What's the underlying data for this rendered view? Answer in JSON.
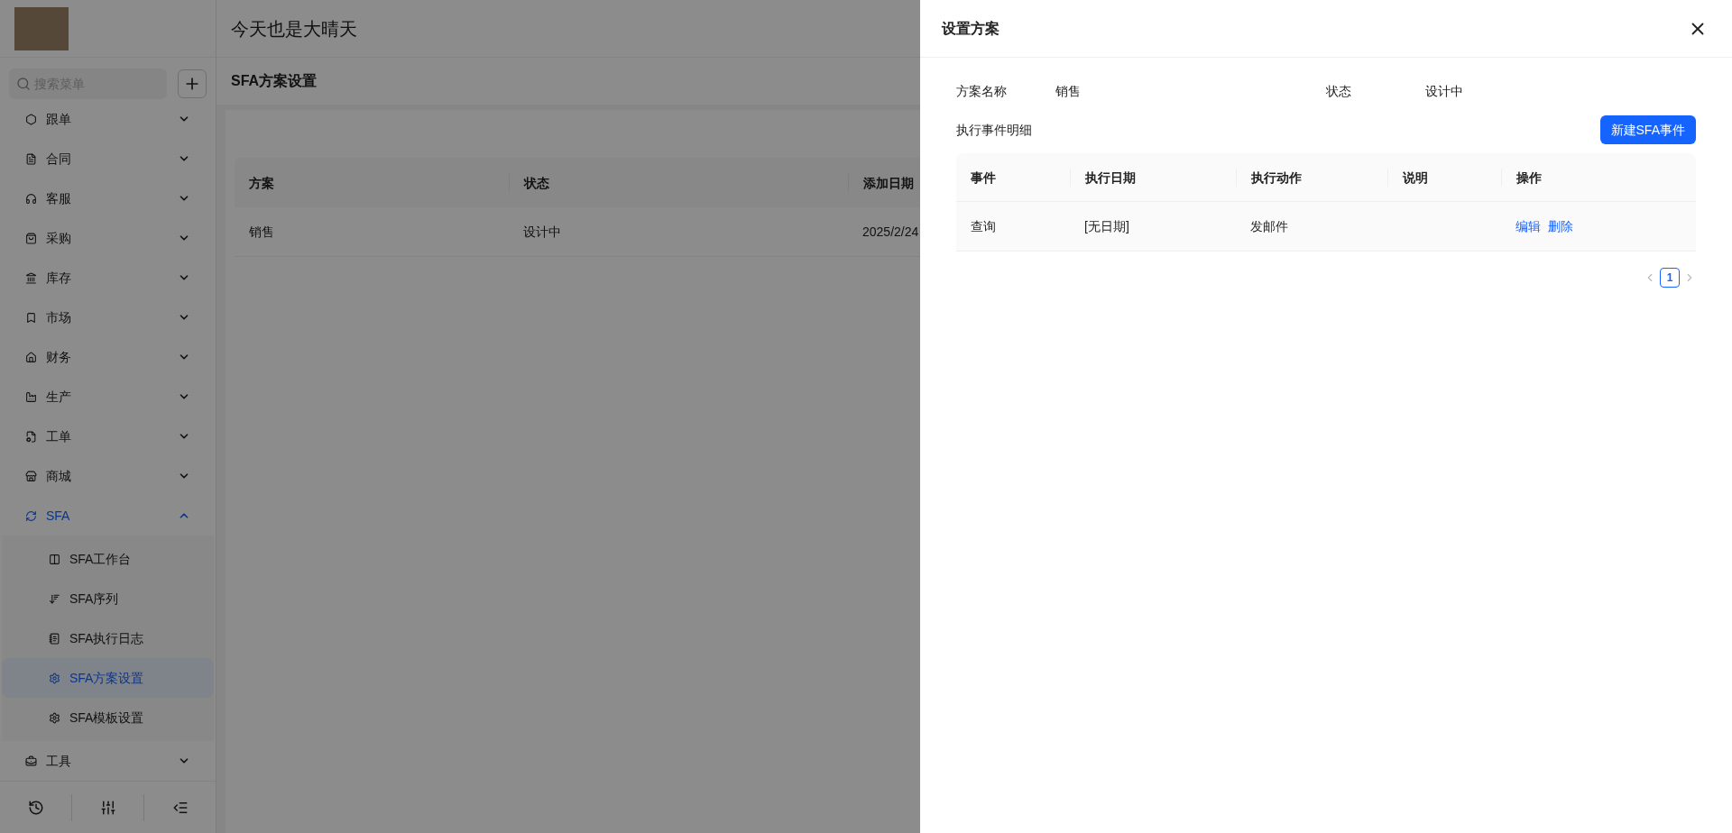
{
  "header": {
    "title": "今天也是大晴天"
  },
  "sidebar": {
    "search": {
      "placeholder": "搜索菜单"
    },
    "menu": [
      {
        "label": "跟单",
        "expanded": false,
        "selected": false
      },
      {
        "label": "合同",
        "expanded": false,
        "selected": false
      },
      {
        "label": "客服",
        "expanded": false,
        "selected": false
      },
      {
        "label": "采购",
        "expanded": false,
        "selected": false
      },
      {
        "label": "库存",
        "expanded": false,
        "selected": false
      },
      {
        "label": "市场",
        "expanded": false,
        "selected": false
      },
      {
        "label": "财务",
        "expanded": false,
        "selected": false
      },
      {
        "label": "生产",
        "expanded": false,
        "selected": false
      },
      {
        "label": "工单",
        "expanded": false,
        "selected": false
      },
      {
        "label": "商城",
        "expanded": false,
        "selected": false
      },
      {
        "label": "SFA",
        "expanded": true,
        "selected": true,
        "children": [
          {
            "label": "SFA工作台",
            "selected": false
          },
          {
            "label": "SFA序列",
            "selected": false
          },
          {
            "label": "SFA执行日志",
            "selected": false
          },
          {
            "label": "SFA方案设置",
            "selected": true
          },
          {
            "label": "SFA模板设置",
            "selected": false
          }
        ]
      },
      {
        "label": "工具",
        "expanded": false,
        "selected": false
      }
    ]
  },
  "page": {
    "title": "SFA方案设置",
    "table": {
      "columns": [
        "方案",
        "状态",
        "添加日期"
      ],
      "rows": [
        [
          "销售",
          "设计中",
          "2025/2/24"
        ]
      ]
    }
  },
  "drawer": {
    "title": "设置方案",
    "fields": [
      {
        "label": "方案名称",
        "value": "销售"
      },
      {
        "label": "状态",
        "value": "设计中"
      }
    ],
    "section_title": "执行事件明细",
    "new_button": "新建SFA事件",
    "table": {
      "columns": [
        "事件",
        "执行日期",
        "执行动作",
        "说明",
        "操作"
      ],
      "rows": [
        {
          "cells": [
            "查询",
            "[无日期]",
            "发邮件",
            ""
          ],
          "actions": [
            "编辑",
            "删除"
          ]
        }
      ]
    },
    "pagination": {
      "pages": [
        {
          "label": "1",
          "selected": true
        }
      ]
    }
  }
}
